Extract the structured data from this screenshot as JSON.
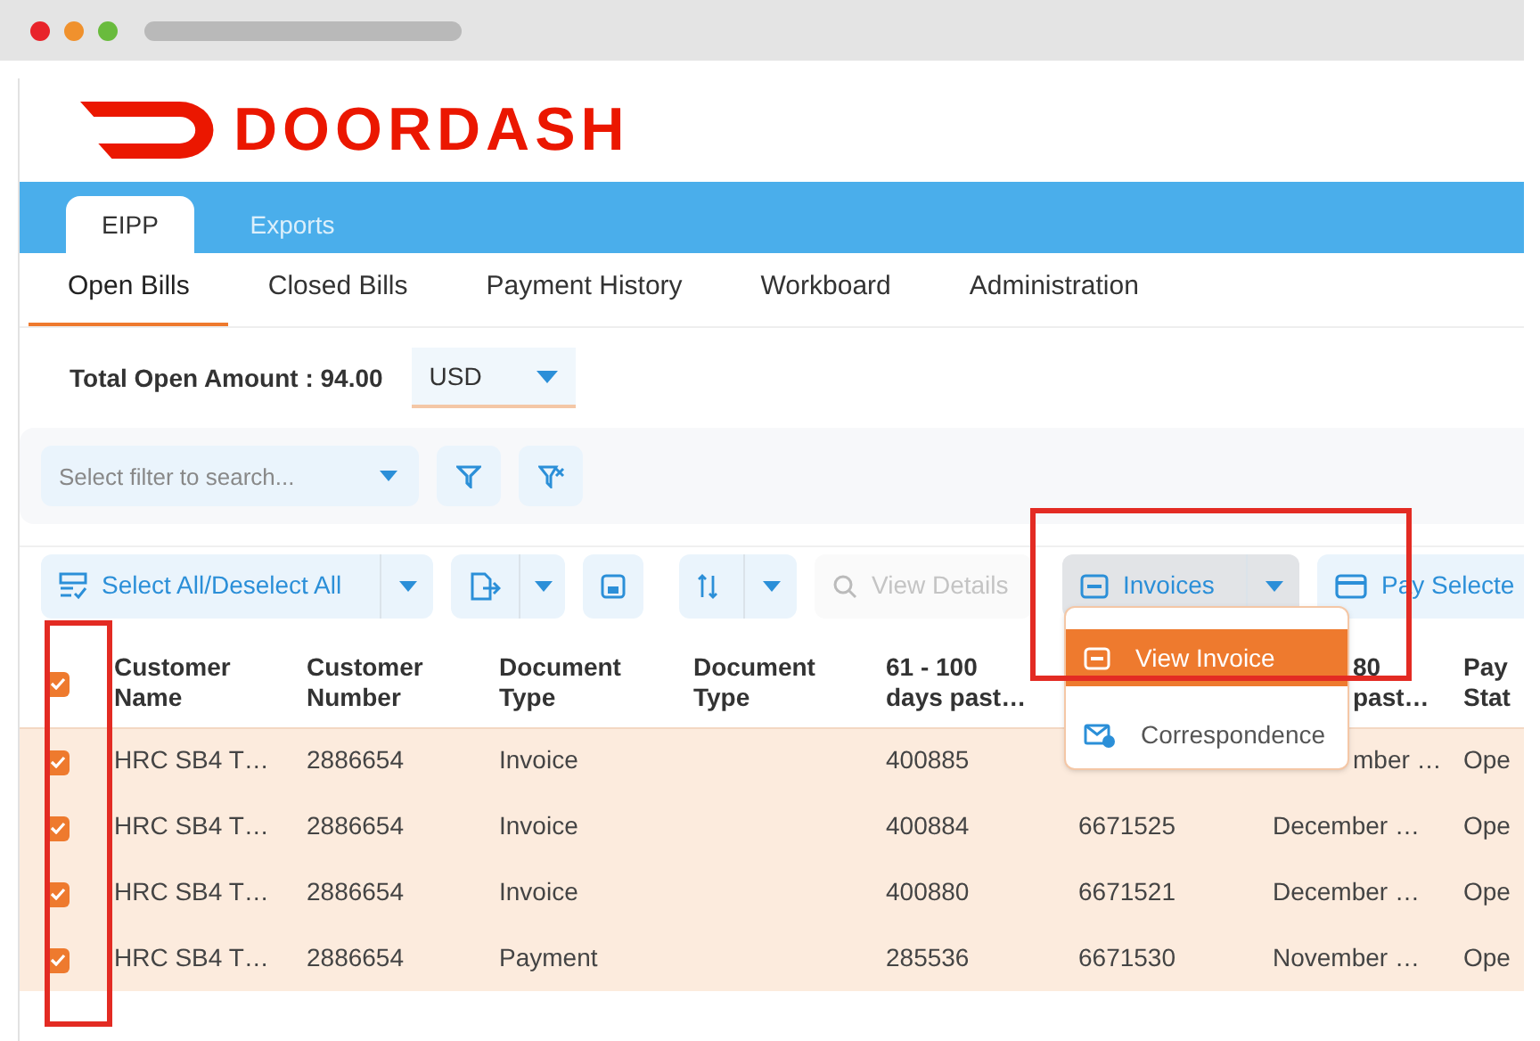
{
  "logo": {
    "text": "DOORDASH"
  },
  "top_tabs": [
    {
      "label": "EIPP",
      "selected": true
    },
    {
      "label": "Exports",
      "selected": false
    }
  ],
  "sub_tabs": [
    {
      "label": "Open Bills",
      "selected": true
    },
    {
      "label": "Closed Bills",
      "selected": false
    },
    {
      "label": "Payment History",
      "selected": false
    },
    {
      "label": "Workboard",
      "selected": false
    },
    {
      "label": "Administration",
      "selected": false
    }
  ],
  "total": {
    "label": "Total Open Amount : 94.00",
    "currency": "USD"
  },
  "filter": {
    "placeholder": "Select filter to search..."
  },
  "toolbar": [
    {
      "kind": "split",
      "label": "Select All/Deselect All",
      "disabled": false,
      "expanded": false
    },
    {
      "kind": "split",
      "disabled": false,
      "expanded": false
    },
    {
      "kind": "icon",
      "disabled": false,
      "expanded": false
    },
    {
      "kind": "split",
      "disabled": false,
      "expanded": false
    },
    {
      "kind": "button",
      "label": "View Details",
      "disabled": true,
      "expanded": false
    },
    {
      "kind": "split",
      "label": "Invoices",
      "disabled": false,
      "expanded": true
    },
    {
      "kind": "button",
      "label": "Pay Selecte",
      "disabled": false,
      "expanded": false
    }
  ],
  "invoice_menu": [
    {
      "label": "View Invoice",
      "selected": true
    },
    {
      "label": "Correspondence",
      "selected": false
    }
  ],
  "table": {
    "all_checked": true,
    "columns": [
      [
        "Customer",
        "Name"
      ],
      [
        "Customer",
        "Number"
      ],
      [
        "Document",
        "Type"
      ],
      [
        "Document",
        "Type"
      ],
      [
        "61 - 100",
        "days past…"
      ],
      null,
      [
        "80",
        "past…"
      ],
      [
        "Pay",
        "Stat"
      ]
    ],
    "rows": [
      {
        "checked": true,
        "cells": [
          "HRC SB4 T…",
          "2886654",
          "Invoice",
          null,
          "400885",
          null,
          "mber …",
          "Ope"
        ]
      },
      {
        "checked": true,
        "cells": [
          "HRC SB4 T…",
          "2886654",
          "Invoice",
          null,
          "400884",
          "6671525",
          "December …",
          "Ope"
        ]
      },
      {
        "checked": true,
        "cells": [
          "HRC SB4 T…",
          "2886654",
          "Invoice",
          null,
          "400880",
          "6671521",
          "December …",
          "Ope"
        ]
      },
      {
        "checked": true,
        "cells": [
          "HRC SB4 T…",
          "2886654",
          "Payment",
          null,
          "285536",
          "6671530",
          "November …",
          "Ope"
        ]
      }
    ]
  }
}
